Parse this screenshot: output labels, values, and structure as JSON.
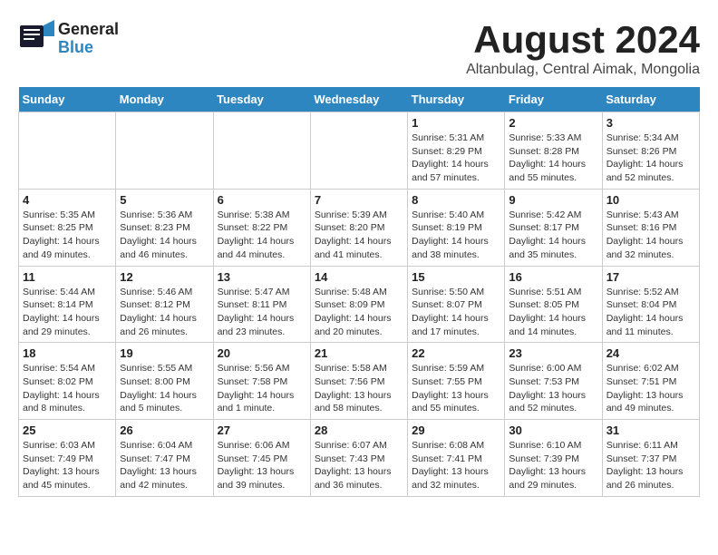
{
  "header": {
    "logo_general": "General",
    "logo_blue": "Blue",
    "month_year": "August 2024",
    "location": "Altanbulag, Central Aimak, Mongolia"
  },
  "weekdays": [
    "Sunday",
    "Monday",
    "Tuesday",
    "Wednesday",
    "Thursday",
    "Friday",
    "Saturday"
  ],
  "weeks": [
    [
      {
        "day": "",
        "detail": ""
      },
      {
        "day": "",
        "detail": ""
      },
      {
        "day": "",
        "detail": ""
      },
      {
        "day": "",
        "detail": ""
      },
      {
        "day": "1",
        "detail": "Sunrise: 5:31 AM\nSunset: 8:29 PM\nDaylight: 14 hours\nand 57 minutes."
      },
      {
        "day": "2",
        "detail": "Sunrise: 5:33 AM\nSunset: 8:28 PM\nDaylight: 14 hours\nand 55 minutes."
      },
      {
        "day": "3",
        "detail": "Sunrise: 5:34 AM\nSunset: 8:26 PM\nDaylight: 14 hours\nand 52 minutes."
      }
    ],
    [
      {
        "day": "4",
        "detail": "Sunrise: 5:35 AM\nSunset: 8:25 PM\nDaylight: 14 hours\nand 49 minutes."
      },
      {
        "day": "5",
        "detail": "Sunrise: 5:36 AM\nSunset: 8:23 PM\nDaylight: 14 hours\nand 46 minutes."
      },
      {
        "day": "6",
        "detail": "Sunrise: 5:38 AM\nSunset: 8:22 PM\nDaylight: 14 hours\nand 44 minutes."
      },
      {
        "day": "7",
        "detail": "Sunrise: 5:39 AM\nSunset: 8:20 PM\nDaylight: 14 hours\nand 41 minutes."
      },
      {
        "day": "8",
        "detail": "Sunrise: 5:40 AM\nSunset: 8:19 PM\nDaylight: 14 hours\nand 38 minutes."
      },
      {
        "day": "9",
        "detail": "Sunrise: 5:42 AM\nSunset: 8:17 PM\nDaylight: 14 hours\nand 35 minutes."
      },
      {
        "day": "10",
        "detail": "Sunrise: 5:43 AM\nSunset: 8:16 PM\nDaylight: 14 hours\nand 32 minutes."
      }
    ],
    [
      {
        "day": "11",
        "detail": "Sunrise: 5:44 AM\nSunset: 8:14 PM\nDaylight: 14 hours\nand 29 minutes."
      },
      {
        "day": "12",
        "detail": "Sunrise: 5:46 AM\nSunset: 8:12 PM\nDaylight: 14 hours\nand 26 minutes."
      },
      {
        "day": "13",
        "detail": "Sunrise: 5:47 AM\nSunset: 8:11 PM\nDaylight: 14 hours\nand 23 minutes."
      },
      {
        "day": "14",
        "detail": "Sunrise: 5:48 AM\nSunset: 8:09 PM\nDaylight: 14 hours\nand 20 minutes."
      },
      {
        "day": "15",
        "detail": "Sunrise: 5:50 AM\nSunset: 8:07 PM\nDaylight: 14 hours\nand 17 minutes."
      },
      {
        "day": "16",
        "detail": "Sunrise: 5:51 AM\nSunset: 8:05 PM\nDaylight: 14 hours\nand 14 minutes."
      },
      {
        "day": "17",
        "detail": "Sunrise: 5:52 AM\nSunset: 8:04 PM\nDaylight: 14 hours\nand 11 minutes."
      }
    ],
    [
      {
        "day": "18",
        "detail": "Sunrise: 5:54 AM\nSunset: 8:02 PM\nDaylight: 14 hours\nand 8 minutes."
      },
      {
        "day": "19",
        "detail": "Sunrise: 5:55 AM\nSunset: 8:00 PM\nDaylight: 14 hours\nand 5 minutes."
      },
      {
        "day": "20",
        "detail": "Sunrise: 5:56 AM\nSunset: 7:58 PM\nDaylight: 14 hours\nand 1 minute."
      },
      {
        "day": "21",
        "detail": "Sunrise: 5:58 AM\nSunset: 7:56 PM\nDaylight: 13 hours\nand 58 minutes."
      },
      {
        "day": "22",
        "detail": "Sunrise: 5:59 AM\nSunset: 7:55 PM\nDaylight: 13 hours\nand 55 minutes."
      },
      {
        "day": "23",
        "detail": "Sunrise: 6:00 AM\nSunset: 7:53 PM\nDaylight: 13 hours\nand 52 minutes."
      },
      {
        "day": "24",
        "detail": "Sunrise: 6:02 AM\nSunset: 7:51 PM\nDaylight: 13 hours\nand 49 minutes."
      }
    ],
    [
      {
        "day": "25",
        "detail": "Sunrise: 6:03 AM\nSunset: 7:49 PM\nDaylight: 13 hours\nand 45 minutes."
      },
      {
        "day": "26",
        "detail": "Sunrise: 6:04 AM\nSunset: 7:47 PM\nDaylight: 13 hours\nand 42 minutes."
      },
      {
        "day": "27",
        "detail": "Sunrise: 6:06 AM\nSunset: 7:45 PM\nDaylight: 13 hours\nand 39 minutes."
      },
      {
        "day": "28",
        "detail": "Sunrise: 6:07 AM\nSunset: 7:43 PM\nDaylight: 13 hours\nand 36 minutes."
      },
      {
        "day": "29",
        "detail": "Sunrise: 6:08 AM\nSunset: 7:41 PM\nDaylight: 13 hours\nand 32 minutes."
      },
      {
        "day": "30",
        "detail": "Sunrise: 6:10 AM\nSunset: 7:39 PM\nDaylight: 13 hours\nand 29 minutes."
      },
      {
        "day": "31",
        "detail": "Sunrise: 6:11 AM\nSunset: 7:37 PM\nDaylight: 13 hours\nand 26 minutes."
      }
    ]
  ]
}
